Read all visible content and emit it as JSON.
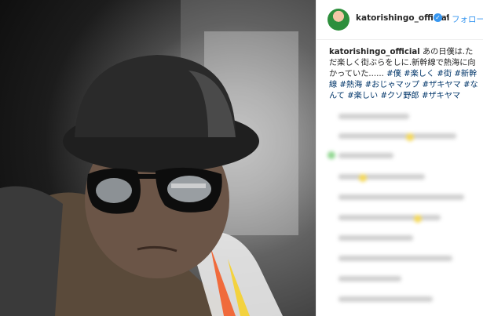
{
  "header": {
    "username": "katorishingo_official",
    "verified_icon": "verified-badge-icon",
    "separator": "•",
    "follow_label": "フォロー"
  },
  "caption": {
    "username": "katorishingo_official",
    "text": " あの日僕は.ただ楽しく街ぶらをしに.新幹線で熱海に向かっていた......",
    "hashtags": "#僕 #楽しく #街 #新幹線 #熱海 #おじゃマップ #ザキヤマ #なんて #楽しい #クソ野郎 #ザキヤマ"
  },
  "colors": {
    "link": "#003569",
    "follow": "#3897f0",
    "border": "#efefef"
  }
}
